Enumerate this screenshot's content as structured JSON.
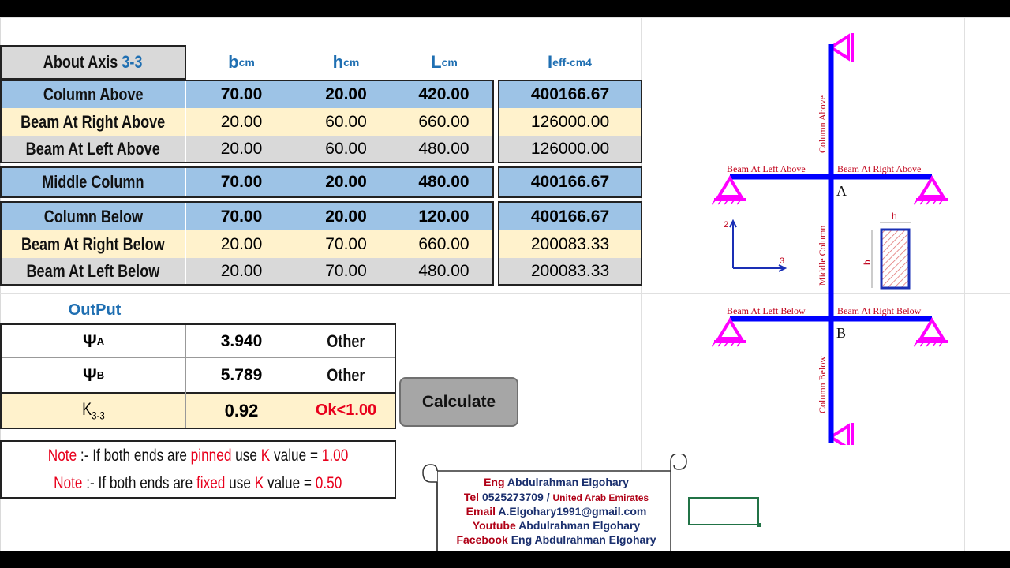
{
  "header": {
    "axis_label": "About Axis ",
    "axis_value": "3-3",
    "cols": [
      {
        "main": "b",
        "sub": "cm"
      },
      {
        "main": "h",
        "sub": "cm"
      },
      {
        "main": "L",
        "sub": "cm"
      },
      {
        "main": "I",
        "sub": "eff-cm4"
      }
    ]
  },
  "rows": [
    {
      "name": "Column Above",
      "b": "70.00",
      "h": "20.00",
      "L": "420.00",
      "I": "400166.67"
    },
    {
      "name": "Beam At Right Above",
      "b": "20.00",
      "h": "60.00",
      "L": "660.00",
      "I": "126000.00"
    },
    {
      "name": "Beam At Left Above",
      "b": "20.00",
      "h": "60.00",
      "L": "480.00",
      "I": "126000.00"
    },
    {
      "name": "Middle Column",
      "b": "70.00",
      "h": "20.00",
      "L": "480.00",
      "I": "400166.67"
    },
    {
      "name": "Column Below",
      "b": "70.00",
      "h": "20.00",
      "L": "120.00",
      "I": "400166.67"
    },
    {
      "name": "Beam At Right Below",
      "b": "20.00",
      "h": "70.00",
      "L": "660.00",
      "I": "200083.33"
    },
    {
      "name": "Beam At Left Below",
      "b": "20.00",
      "h": "70.00",
      "L": "480.00",
      "I": "200083.33"
    }
  ],
  "output": {
    "title": "OutPut",
    "psi_a": {
      "symbol": "Ψ",
      "sub": "A",
      "value": "3.940",
      "type": "Other"
    },
    "psi_b": {
      "symbol": "Ψ",
      "sub": "B",
      "value": "5.789",
      "type": "Other"
    },
    "k": {
      "symbol": "K",
      "sub": "3-3",
      "value": "0.92",
      "status": "Ok<1.00"
    }
  },
  "calculate_label": "Calculate",
  "notes": [
    {
      "prefix": "Note",
      "t1": " :- If both ends are ",
      "kw": "pinned",
      "t2": " use ",
      "k": "K",
      "t3": " value = ",
      "val": "1.00"
    },
    {
      "prefix": "Note",
      "t1": " :- If both ends are ",
      "kw": "fixed",
      "t2": " use ",
      "k": "K",
      "t3": " value = ",
      "val": "0.50"
    }
  ],
  "contact": {
    "eng_label": "Eng",
    "eng_name": "Abdulrahman Elgohary",
    "tel_label": "Tel",
    "tel_number": "0525273709",
    "tel_sep": "/",
    "tel_country": "United Arab Emirates",
    "email_label": "Email",
    "email_value": "A.Elgohary1991@gmail.com",
    "youtube_label": "Youtube",
    "youtube_value": "Abdulrahman Elgohary",
    "facebook_label": "Facebook",
    "facebook_value": "Eng Abdulrahman Elgohary"
  },
  "diagram": {
    "column_above": "Column Above",
    "middle_column": "Middle Column",
    "column_below": "Column Below",
    "beam_left_above": "Beam At Left Above",
    "beam_right_above": "Beam At Right Above",
    "beam_left_below": "Beam At Left Below",
    "beam_right_below": "Beam At Right Below",
    "joint_a": "A",
    "joint_b": "B",
    "axis_2": "2",
    "axis_3": "3",
    "sec_h": "h",
    "sec_b": "b"
  },
  "colors": {
    "frame": "#0000ff",
    "support": "#ff00ff",
    "header_blue": "#1f6fb2",
    "label_red": "#c0001a"
  }
}
